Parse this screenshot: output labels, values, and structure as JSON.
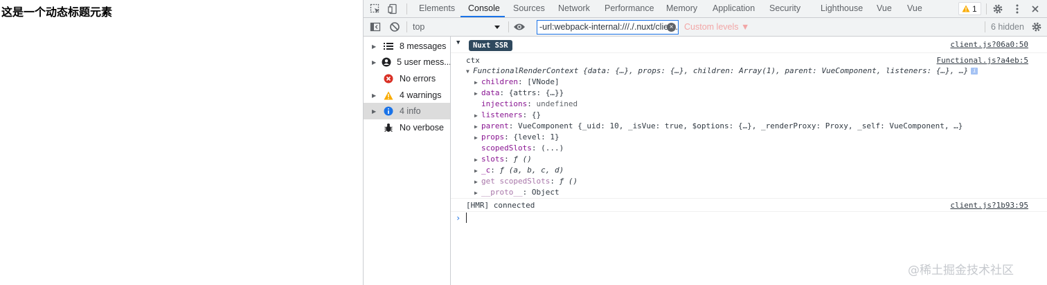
{
  "page": {
    "heading": "这是一个动态标题元素"
  },
  "devtools": {
    "tabs": [
      "Elements",
      "Console",
      "Sources",
      "Network",
      "Performance",
      "Memory",
      "Application",
      "Security",
      "Lighthouse",
      "Vue",
      "Vue"
    ],
    "active_tab": "Console",
    "warning_badge_count": "1",
    "toolbar": {
      "context": "top",
      "filter_value": "-url:webpack-internal:///./.nuxt/client.js",
      "levels_label": "Custom levels ▼",
      "hidden_label": "6 hidden"
    },
    "sidebar": [
      {
        "label": "8 messages",
        "icon": "list-icon"
      },
      {
        "label": "5 user mess...",
        "icon": "user-icon"
      },
      {
        "label": "No errors",
        "icon": "error-icon"
      },
      {
        "label": "4 warnings",
        "icon": "warning-icon"
      },
      {
        "label": "4 info",
        "icon": "info-icon",
        "selected": true
      },
      {
        "label": "No verbose",
        "icon": "bug-icon"
      }
    ],
    "console": {
      "nuxt_badge": "Nuxt SSR",
      "nuxt_source": "client.js?06a0:50",
      "ctx_label": "ctx",
      "ctx_source": "Functional.js?a4eb:5",
      "object_summary_name": "FunctionalRenderContext",
      "object_summary_rest": " {data: {…}, props: {…}, children: Array(1), parent: VueComponent, listeners: {…}, …}",
      "properties": [
        {
          "key": "children",
          "value": "[VNode]",
          "expandable": true
        },
        {
          "key": "data",
          "value": "{attrs: {…}}",
          "expandable": true
        },
        {
          "key": "injections",
          "value": "undefined",
          "expandable": false
        },
        {
          "key": "listeners",
          "value": "{}",
          "expandable": true
        },
        {
          "key": "parent",
          "value": "VueComponent {_uid: 10, _isVue: true, $options: {…}, _renderProxy: Proxy, _self: VueComponent, …}",
          "expandable": true
        },
        {
          "key": "props",
          "value": "{level: 1}",
          "expandable": true
        },
        {
          "key": "scopedSlots",
          "value": "(...)",
          "expandable": false
        },
        {
          "key": "slots",
          "value": "ƒ ()",
          "expandable": true
        },
        {
          "key": "_c",
          "value": "ƒ (a, b, c, d)",
          "expandable": true
        },
        {
          "key": "get scopedSlots",
          "value": "ƒ ()",
          "expandable": true
        },
        {
          "key": "__proto__",
          "value": "Object",
          "expandable": true
        }
      ],
      "hmr_message": "[HMR] connected",
      "hmr_source": "client.js?1b93:95",
      "prompt_symbol": "›"
    }
  },
  "watermark": "@稀土掘金技术社区",
  "colors": {
    "accent": "#1a73e8",
    "nuxt_badge_bg": "#2f495e",
    "error": "#d93025",
    "warning": "#f9ab00",
    "info": "#1a73e8"
  }
}
